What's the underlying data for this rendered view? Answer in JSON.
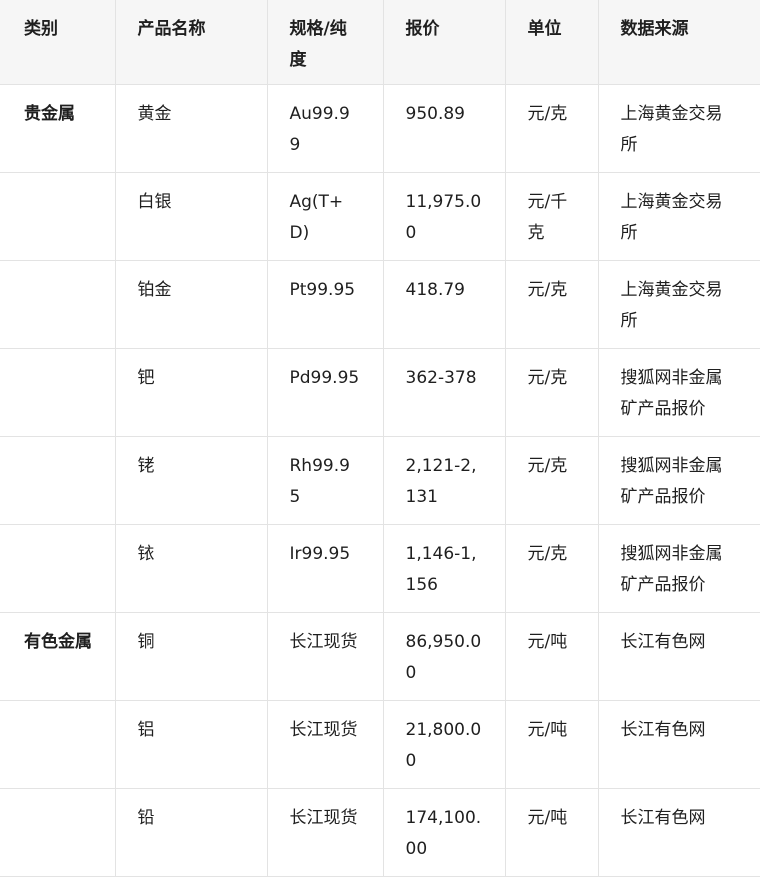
{
  "table": {
    "headers": [
      "类别",
      "产品名称",
      "规格/纯度",
      "报价",
      "单位",
      "数据来源"
    ],
    "rows": [
      {
        "category": "贵金属",
        "product": "黄金",
        "spec": "Au99.99",
        "price": "950.89",
        "unit": "元/克",
        "source": "上海黄金交易所"
      },
      {
        "category": "",
        "product": "白银",
        "spec": "Ag(T+D)",
        "price": "11,975.00",
        "unit": "元/千克",
        "source": "上海黄金交易所"
      },
      {
        "category": "",
        "product": "铂金",
        "spec": "Pt99.95",
        "price": "418.79",
        "unit": "元/克",
        "source": "上海黄金交易所"
      },
      {
        "category": "",
        "product": "钯",
        "spec": "Pd99.95",
        "price": "362-378",
        "unit": "元/克",
        "source": "搜狐网非金属矿产品报价"
      },
      {
        "category": "",
        "product": "铑",
        "spec": "Rh99.95",
        "price": "2,121-2,131",
        "unit": "元/克",
        "source": "搜狐网非金属矿产品报价"
      },
      {
        "category": "",
        "product": "铱",
        "spec": "Ir99.95",
        "price": "1,146-1,156",
        "unit": "元/克",
        "source": "搜狐网非金属矿产品报价"
      },
      {
        "category": "有色金属",
        "product": "铜",
        "spec": "长江现货",
        "price": "86,950.00",
        "unit": "元/吨",
        "source": "长江有色网"
      },
      {
        "category": "",
        "product": "铝",
        "spec": "长江现货",
        "price": "21,800.00",
        "unit": "元/吨",
        "source": "长江有色网"
      },
      {
        "category": "",
        "product": "铅",
        "spec": "长江现货",
        "price": "174,100.00",
        "unit": "元/吨",
        "source": "长江有色网"
      }
    ]
  }
}
